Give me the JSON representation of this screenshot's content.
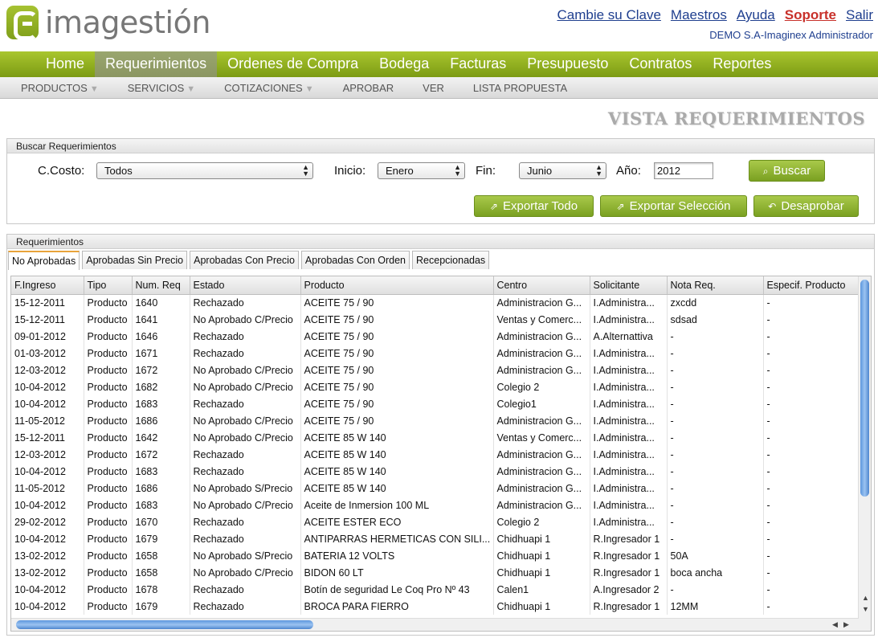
{
  "brand": {
    "name": "imagestión",
    "accent": "#8cad1f"
  },
  "toplinks": [
    "Cambie su Clave",
    "Maestros",
    "Ayuda",
    "Soporte",
    "Salir"
  ],
  "user": "DEMO S.A-Imaginex Administrador",
  "mainnav": [
    "Home",
    "Requerimientos",
    "Ordenes de Compra",
    "Bodega",
    "Facturas",
    "Presupuesto",
    "Contratos",
    "Reportes"
  ],
  "subnav": [
    {
      "label": "PRODUCTOS",
      "dropdown": true
    },
    {
      "label": "SERVICIOS",
      "dropdown": true
    },
    {
      "label": "COTIZACIONES",
      "dropdown": true
    },
    {
      "label": "APROBAR",
      "dropdown": false
    },
    {
      "label": "VER",
      "dropdown": false
    },
    {
      "label": "LISTA PROPUESTA",
      "dropdown": false
    }
  ],
  "page_title": "VISTA REQUERIMIENTOS",
  "search": {
    "title": "Buscar Requerimientos",
    "ccosto_label": "C.Costo:",
    "ccosto_value": "Todos",
    "inicio_label": "Inicio:",
    "inicio_value": "Enero",
    "fin_label": "Fin:",
    "fin_value": "Junio",
    "anio_label": "Año:",
    "anio_value": "2012",
    "buscar": "Buscar",
    "exportar_todo": "Exportar Todo",
    "exportar_seleccion": "Exportar Selección",
    "desaprobar": "Desaprobar"
  },
  "requerimientos": {
    "title": "Requerimientos",
    "tabs": [
      "No Aprobadas",
      "Aprobadas Sin Precio",
      "Aprobadas Con Precio",
      "Aprobadas Con Orden",
      "Recepcionadas"
    ],
    "columns": [
      "F.Ingreso",
      "Tipo",
      "Num. Req",
      "Estado",
      "Producto",
      "Centro",
      "Solicitante",
      "Nota Req.",
      "Especif. Producto"
    ],
    "rows": [
      [
        "15-12-2011",
        "Producto",
        "1640",
        "Rechazado",
        "ACEITE 75 / 90",
        "Administracion G...",
        "I.Administra...",
        "zxcdd",
        "-"
      ],
      [
        "15-12-2011",
        "Producto",
        "1641",
        "No Aprobado C/Precio",
        "ACEITE 75 / 90",
        "Ventas y Comerc...",
        "I.Administra...",
        "sdsad",
        "-"
      ],
      [
        "09-01-2012",
        "Producto",
        "1646",
        "Rechazado",
        "ACEITE 75 / 90",
        "Administracion G...",
        "A.Alternattiva",
        "-",
        "-"
      ],
      [
        "01-03-2012",
        "Producto",
        "1671",
        "Rechazado",
        "ACEITE 75 / 90",
        "Administracion G...",
        "I.Administra...",
        "-",
        "-"
      ],
      [
        "12-03-2012",
        "Producto",
        "1672",
        "No Aprobado C/Precio",
        "ACEITE 75 / 90",
        "Administracion G...",
        "I.Administra...",
        "-",
        "-"
      ],
      [
        "10-04-2012",
        "Producto",
        "1682",
        "No Aprobado C/Precio",
        "ACEITE 75 / 90",
        "Colegio 2",
        "I.Administra...",
        "-",
        "-"
      ],
      [
        "10-04-2012",
        "Producto",
        "1683",
        "Rechazado",
        "ACEITE 75 / 90",
        "Colegio1",
        "I.Administra...",
        "-",
        "-"
      ],
      [
        "11-05-2012",
        "Producto",
        "1686",
        "No Aprobado C/Precio",
        "ACEITE 75 / 90",
        "Administracion G...",
        "I.Administra...",
        "-",
        "-"
      ],
      [
        "15-12-2011",
        "Producto",
        "1642",
        "No Aprobado C/Precio",
        "ACEITE 85 W 140",
        "Ventas y Comerc...",
        "I.Administra...",
        "-",
        "-"
      ],
      [
        "12-03-2012",
        "Producto",
        "1672",
        "Rechazado",
        "ACEITE 85 W 140",
        "Administracion G...",
        "I.Administra...",
        "-",
        "-"
      ],
      [
        "10-04-2012",
        "Producto",
        "1683",
        "Rechazado",
        "ACEITE 85 W 140",
        "Administracion G...",
        "I.Administra...",
        "-",
        "-"
      ],
      [
        "11-05-2012",
        "Producto",
        "1686",
        "No Aprobado S/Precio",
        "ACEITE 85 W 140",
        "Administracion G...",
        "I.Administra...",
        "-",
        "-"
      ],
      [
        "10-04-2012",
        "Producto",
        "1683",
        "No Aprobado C/Precio",
        "Aceite de Inmersion 100 ML",
        "Administracion G...",
        "I.Administra...",
        "-",
        "-"
      ],
      [
        "29-02-2012",
        "Producto",
        "1670",
        "Rechazado",
        "ACEITE ESTER ECO",
        "Colegio 2",
        "I.Administra...",
        "-",
        "-"
      ],
      [
        "10-04-2012",
        "Producto",
        "1679",
        "Rechazado",
        "ANTIPARRAS HERMETICAS CON SILI...",
        "Chidhuapi 1",
        "R.Ingresador 1",
        "-",
        "-"
      ],
      [
        "13-02-2012",
        "Producto",
        "1658",
        "No Aprobado S/Precio",
        "BATERIA 12 VOLTS",
        "Chidhuapi 1",
        "R.Ingresador 1",
        "50A",
        "-"
      ],
      [
        "13-02-2012",
        "Producto",
        "1658",
        "No Aprobado C/Precio",
        "BIDON 60 LT",
        "Chidhuapi 1",
        "R.Ingresador 1",
        "boca ancha",
        "-"
      ],
      [
        "10-04-2012",
        "Producto",
        "1678",
        "Rechazado",
        "Botín de seguridad Le Coq Pro Nº 43",
        "Calen1",
        "A.Ingresador 2",
        "-",
        "-"
      ],
      [
        "10-04-2012",
        "Producto",
        "1679",
        "Rechazado",
        "BROCA PARA FIERRO",
        "Chidhuapi 1",
        "R.Ingresador 1",
        "12MM",
        "-"
      ]
    ]
  },
  "icons": {
    "search": "magnifier-icon",
    "export": "external-link-icon",
    "undo": "undo-arrow-icon"
  }
}
